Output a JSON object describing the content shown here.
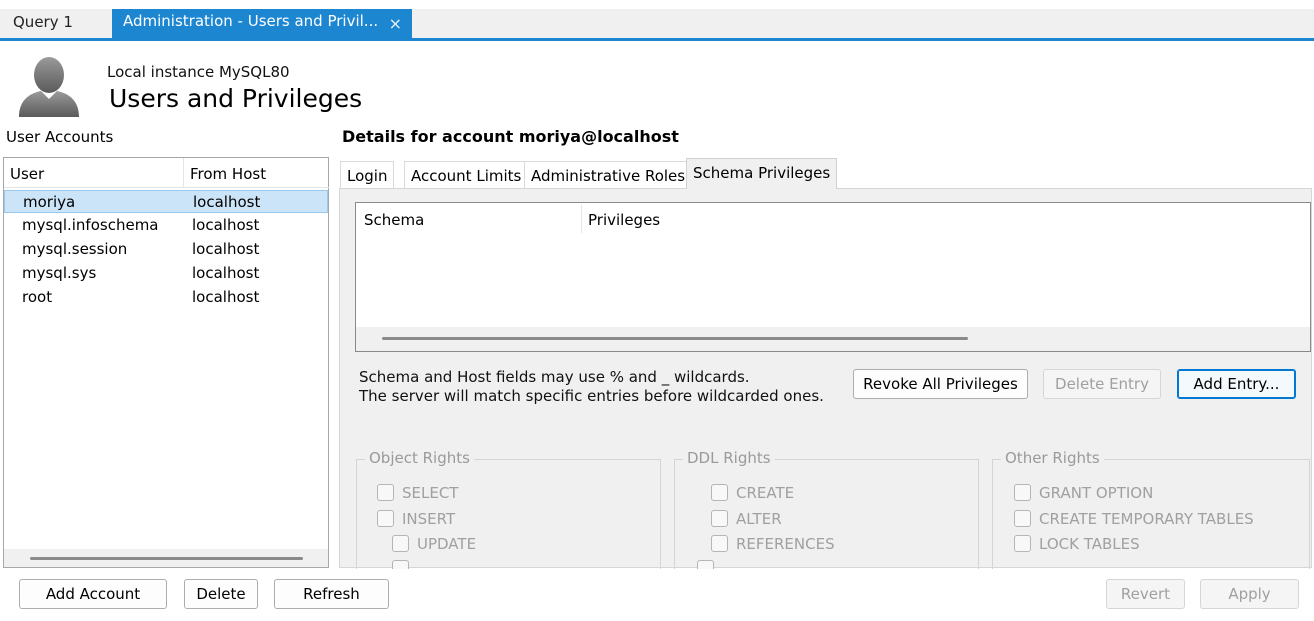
{
  "tabs": [
    {
      "label": "Query 1"
    },
    {
      "label": "Administration - Users and Privil...",
      "close": "×"
    }
  ],
  "header": {
    "instance": "Local instance MySQL80",
    "title": "Users and Privileges"
  },
  "accounts": {
    "label": "User Accounts",
    "columns": [
      "User",
      "From Host"
    ],
    "rows": [
      {
        "user": "moriya",
        "host": "localhost",
        "selected": true
      },
      {
        "user": "mysql.infoschema",
        "host": "localhost"
      },
      {
        "user": "mysql.session",
        "host": "localhost"
      },
      {
        "user": "mysql.sys",
        "host": "localhost"
      },
      {
        "user": "root",
        "host": "localhost"
      }
    ]
  },
  "details": {
    "title": "Details for account moriya@localhost",
    "tabs": [
      "Login",
      "Account Limits",
      "Administrative Roles",
      "Schema Privileges"
    ],
    "active_tab": "Schema Privileges",
    "table_columns": [
      "Schema",
      "Privileges"
    ],
    "hint_line1": "Schema and Host fields may use % and _ wildcards.",
    "hint_line2": "The server will match specific entries before wildcarded ones.",
    "buttons": {
      "revoke": "Revoke All Privileges",
      "delete_entry": "Delete Entry",
      "add_entry": "Add Entry..."
    },
    "groups": {
      "object": {
        "title": "Object Rights",
        "items": [
          "SELECT",
          "INSERT",
          "UPDATE"
        ]
      },
      "ddl": {
        "title": "DDL Rights",
        "items": [
          "CREATE",
          "ALTER",
          "REFERENCES"
        ]
      },
      "other": {
        "title": "Other Rights",
        "items": [
          "GRANT OPTION",
          "CREATE TEMPORARY TABLES",
          "LOCK TABLES"
        ]
      }
    }
  },
  "bottom": {
    "add_account": "Add Account",
    "delete": "Delete",
    "refresh": "Refresh",
    "revert": "Revert",
    "apply": "Apply"
  },
  "colors": {
    "accent": "#1c86d1",
    "selection": "#cce4f7",
    "panel_bg": "#f0f0f0",
    "disabled_text": "#a0a0a0"
  },
  "icons": {
    "avatar": "user-silhouette-icon",
    "close": "close-icon"
  }
}
